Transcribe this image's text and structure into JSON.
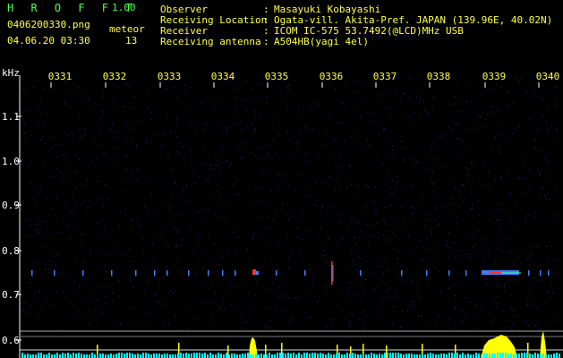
{
  "header": {
    "app_title": "H R O F F T",
    "version": "1.00",
    "file_name": "0406200330.png",
    "datetime": "04.06.20 03:30",
    "meteor_label": "meteor",
    "meteor_count": "13",
    "fields": [
      {
        "key": "Observer",
        "sep": ":",
        "value": "Masayuki Kobayashi"
      },
      {
        "key": "Receiving Location",
        "sep": ":",
        "value": "Ogata-vill. Akita-Pref. JAPAN (139.96E, 40.02N)"
      },
      {
        "key": "Receiver",
        "sep": ":",
        "value": "ICOM IC-575 53.7492(@LCD)MHz USB"
      },
      {
        "key": "Receiving antenna",
        "sep": ":",
        "value": "A504HB(yagi 4el)"
      }
    ]
  },
  "spectrogram": {
    "unit_label": "kHz",
    "y_ticks": [
      "1.1",
      "1.0",
      "0.9",
      "0.8",
      "0.7",
      "0.6"
    ],
    "x_ticks": [
      "0331",
      "0332",
      "0333",
      "0334",
      "0335",
      "0336",
      "0337",
      "0338",
      "0339",
      "0340"
    ],
    "colors": {
      "background": "#000000",
      "noise": "#1a1a5c",
      "grid": "#ffffff",
      "meteor": "#4080ff",
      "meteor_hot": "#ff3030",
      "baseline": "#ffffff",
      "power": "#ffff00",
      "power_low": "#00ffff"
    }
  }
}
